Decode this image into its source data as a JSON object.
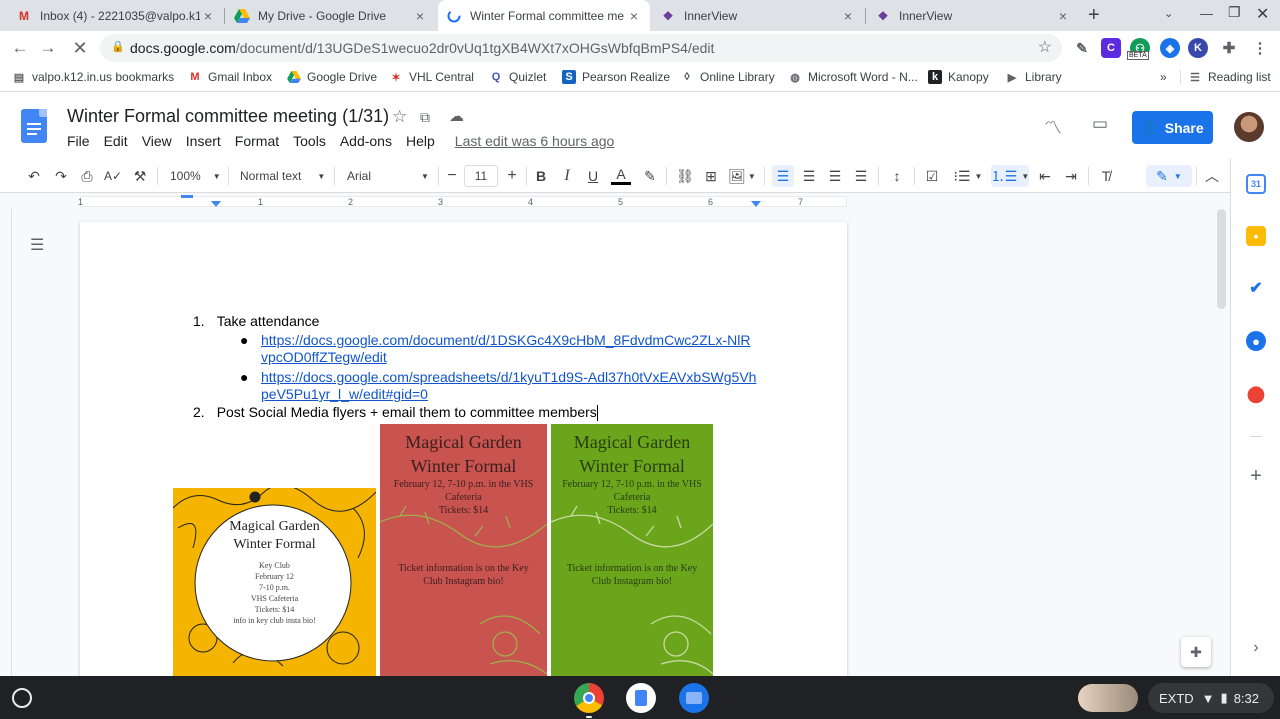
{
  "browser": {
    "tabs": [
      {
        "icon": "gmail-icon",
        "title": "Inbox (4) - 2221035@valpo.k1",
        "close": "×"
      },
      {
        "icon": "google-drive-icon",
        "title": "My Drive - Google Drive",
        "close": "×"
      },
      {
        "icon": "loading-icon",
        "title": "Winter Formal committee me",
        "close": "×"
      },
      {
        "icon": "innerview-icon",
        "title": "InnerView",
        "close": "×"
      },
      {
        "icon": "innerview-icon",
        "title": "InnerView",
        "close": "×"
      }
    ],
    "new_tab": "+",
    "url_host": "docs.google.com",
    "url_path": "/document/d/13UGDeS1wecuo2dr0vUq1tgXB4WXt7xOHGsWbfqBmPS4/edit",
    "ext_beta": "BETA"
  },
  "bookmarks": {
    "items": [
      {
        "icon": "folder-icon",
        "label": "valpo.k12.in.us bookmarks"
      },
      {
        "icon": "gmail-icon",
        "label": "Gmail Inbox"
      },
      {
        "icon": "google-drive-icon",
        "label": "Google Drive"
      },
      {
        "icon": "vhl-icon",
        "label": "VHL Central"
      },
      {
        "icon": "quizlet-icon",
        "label": "Quizlet"
      },
      {
        "icon": "pearson-icon",
        "label": "Pearson Realize"
      },
      {
        "icon": "library-icon",
        "label": "Online Library"
      },
      {
        "icon": "globe-icon",
        "label": "Microsoft Word - N..."
      },
      {
        "icon": "kanopy-icon",
        "label": "Kanopy"
      },
      {
        "icon": "play-icon",
        "label": "Library"
      }
    ],
    "more": "»",
    "reading_list": "Reading list"
  },
  "docs": {
    "title": "Winter Formal committee meeting (1/31)",
    "menu": [
      "File",
      "Edit",
      "View",
      "Insert",
      "Format",
      "Tools",
      "Add-ons",
      "Help"
    ],
    "last_edit": "Last edit was 6 hours ago",
    "share_label": "Share"
  },
  "toolbar": {
    "zoom": "100%",
    "style": "Normal text",
    "font": "Arial",
    "font_size": "11",
    "minus": "−",
    "plus": "+",
    "bold": "B",
    "italic": "I",
    "underline": "U",
    "text_color": "A"
  },
  "ruler": {
    "numbers": [
      "1",
      "1",
      "2",
      "3",
      "4",
      "5",
      "6",
      "7"
    ]
  },
  "document": {
    "items": [
      {
        "number": "1.",
        "text": "Take attendance"
      },
      {
        "number": "2.",
        "text": "Post Social Media flyers + email them to committee members"
      }
    ],
    "links": [
      {
        "line1": "https://docs.google.com/document/d/1DSKGc4X9cHbM_8FdvdmCwc2ZLx-NlR",
        "line2": "vpcOD0ffZTegw/edit"
      },
      {
        "line1": "https://docs.google.com/spreadsheets/d/1kyuT1d9S-Adl37h0tVxEAVxbSWg5Vh",
        "line2": "peV5Pu1yr_l_w/edit#gid=0"
      }
    ],
    "flyers": [
      {
        "bg": "#f4b400",
        "heading1": "Magical Garden",
        "heading2": "Winter Formal",
        "lines": [
          "Key Club",
          "February 12",
          "7-10 p.m.",
          "VHS Cafeteria",
          "Tickets: $14",
          "info in key club insta bio!"
        ]
      },
      {
        "bg": "#c9534f",
        "heading1": "Magical Garden",
        "heading2": "Winter Formal",
        "lines": [
          "February 12, 7-10 p.m. in the VHS",
          "Cafeteria",
          "Tickets: $14"
        ],
        "footer": [
          "Ticket information is on the Key",
          "Club Instagram bio!"
        ]
      },
      {
        "bg": "#6aa51b",
        "heading1": "Magical Garden",
        "heading2": "Winter Formal",
        "lines": [
          "February 12, 7-10 p.m. in the VHS",
          "Cafeteria",
          "Tickets: $14"
        ],
        "footer": [
          "Ticket information is on the Key",
          "Club Instagram bio!"
        ]
      }
    ]
  },
  "shelf": {
    "status_text": "EXTD",
    "time": "8:32"
  },
  "colors": {
    "accent": "#1a73e8",
    "link": "#1155cc",
    "tabstrip": "#dee1e6",
    "shelf": "#202124"
  }
}
